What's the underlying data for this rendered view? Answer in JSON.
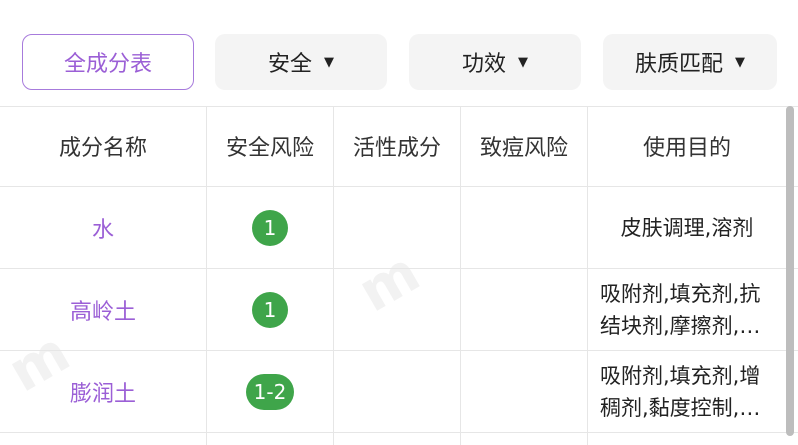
{
  "filters": {
    "all_label": "全成分表",
    "safety_label": "安全",
    "efficacy_label": "功效",
    "skin_match_label": "肤质匹配",
    "caret": "▼"
  },
  "table": {
    "headers": [
      "成分名称",
      "安全风险",
      "活性成分",
      "致痘风险",
      "使用目的"
    ],
    "rows": [
      {
        "name": "水",
        "safety": "1",
        "active": "",
        "acne": "",
        "purpose": "皮肤调理,溶剂"
      },
      {
        "name": "高岭土",
        "safety": "1",
        "active": "",
        "acne": "",
        "purpose": "吸附剂,填充剂,抗\n结块剂,摩擦剂,…"
      },
      {
        "name": "膨润土",
        "safety": "1-2",
        "active": "",
        "acne": "",
        "purpose": "吸附剂,填充剂,增\n稠剂,黏度控制,…"
      }
    ]
  },
  "colors": {
    "accent_purple": "#9b5fd6",
    "safety_green": "#3fa54a"
  }
}
